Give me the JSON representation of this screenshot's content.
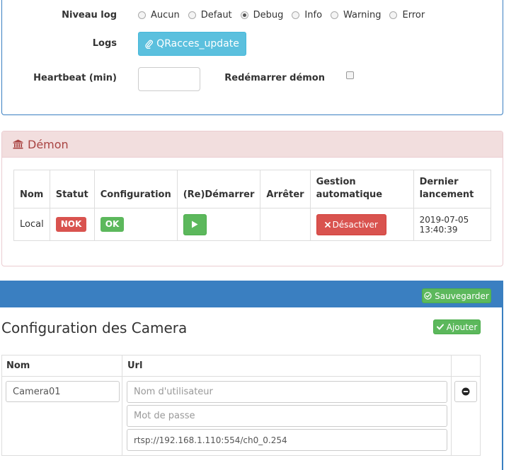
{
  "log_settings": {
    "label": "Niveau log",
    "options": [
      "Aucun",
      "Defaut",
      "Debug",
      "Info",
      "Warning",
      "Error"
    ],
    "selected": "Debug"
  },
  "logs": {
    "label": "Logs",
    "button_label": "QRacces_update",
    "icon": "paperclip-icon"
  },
  "heartbeat": {
    "label": "Heartbeat (min)",
    "value": ""
  },
  "restart_daemon": {
    "label": "Redémarrer démon",
    "checked": false
  },
  "daemon": {
    "title": "Démon",
    "icon": "bank-icon",
    "columns": [
      "Nom",
      "Statut",
      "Configuration",
      "(Re)Démarrer",
      "Arrêter",
      "Gestion automatique",
      "Dernier lancement"
    ],
    "row": {
      "name": "Local",
      "status": "NOK",
      "configuration": "OK",
      "stop": "",
      "auto_button": "Désactiver",
      "last_launch": "2019-07-05 13:40:39"
    },
    "colors": {
      "status": "#d9534f",
      "configuration": "#5cb85c",
      "heading_bg": "#f2dede",
      "heading_text": "#a94442"
    }
  },
  "camera_config": {
    "save_button": "Sauvegarder",
    "title": "Configuration des Camera",
    "add_button": "Ajouter",
    "columns": [
      "Nom",
      "Url"
    ],
    "camera": {
      "name": "Camera01",
      "username_placeholder": "Nom d'utilisateur",
      "password_placeholder": "Mot de passe",
      "url": "rtsp://192.168.1.110:554/ch0_0.254"
    },
    "colors": {
      "bar": "#3a7fc1",
      "button": "#5cb85c"
    }
  }
}
